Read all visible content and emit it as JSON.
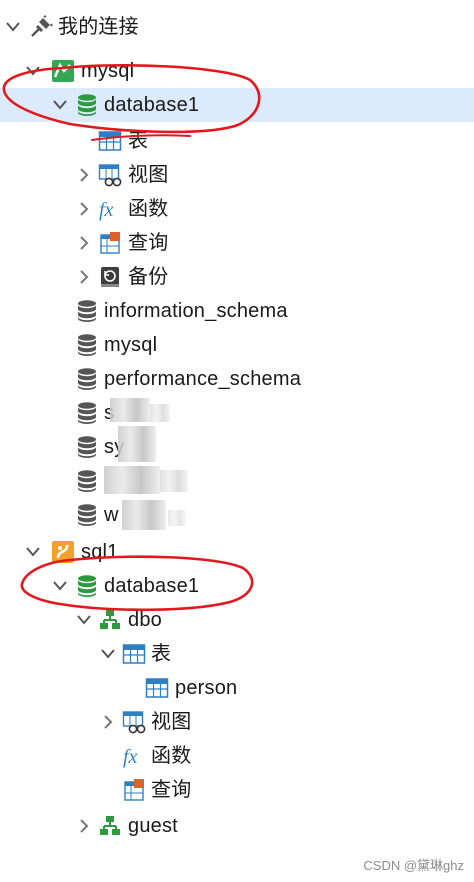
{
  "tree": {
    "root_label": "我的连接",
    "mysql": {
      "label": "mysql",
      "database1": {
        "label": "database1",
        "tables": "表",
        "views": "视图",
        "functions": "函数",
        "queries": "查询",
        "backups": "备份"
      },
      "other_dbs": [
        "information_schema",
        "mysql",
        "performance_schema",
        "s",
        "sy",
        "",
        "w"
      ]
    },
    "sql1": {
      "label": "sql1",
      "database1": {
        "label": "database1",
        "dbo": {
          "label": "dbo",
          "tables": "表",
          "table_person": "person",
          "views": "视图",
          "functions": "函数",
          "queries": "查询"
        },
        "guest": "guest"
      }
    }
  },
  "watermark": "CSDN @黛琳ghz",
  "colors": {
    "selected_bg": "#dcebfb",
    "annotation": "#e3171d",
    "db_green": "#2e9a3f",
    "db_gray": "#555555"
  }
}
